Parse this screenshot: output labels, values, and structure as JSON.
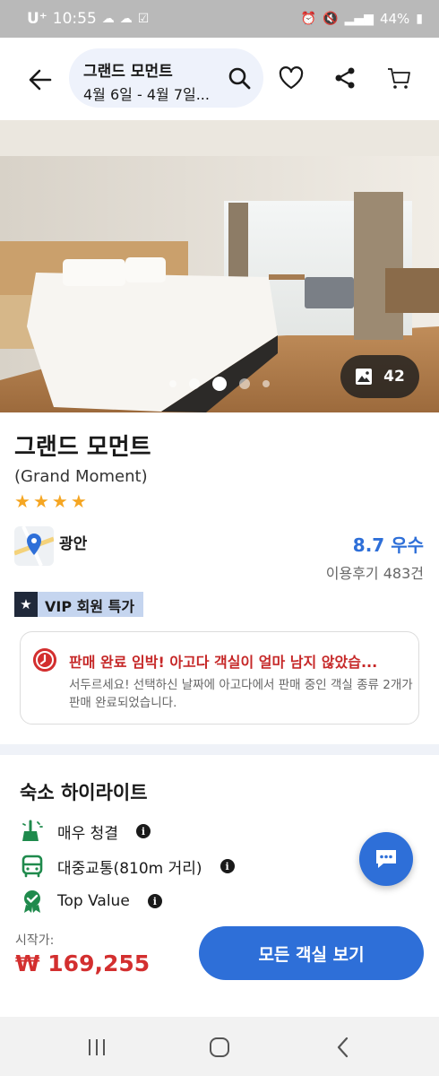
{
  "status_bar": {
    "carrier": "U⁺",
    "time": "10:55",
    "battery": "44%"
  },
  "header": {
    "hotel_title": "그랜드 모먼트",
    "dates": "4월 6일 - 4월 7일..."
  },
  "gallery": {
    "photo_count": "42",
    "total_dots": 5,
    "active_dot": 3
  },
  "hotel": {
    "name": "그랜드 모먼트",
    "english_name": "(Grand Moment)",
    "star_rating": 4,
    "location": "광안",
    "rating": "8.7 우수",
    "reviews": "이용후기 483건",
    "vip_badge": "VIP 회원 특가"
  },
  "alert": {
    "title": "판매 완료 임박! 아고다 객실이 얼마 남지 않았습...",
    "body": "서두르세요! 선택하신 날짜에 아고다에서 판매 중인 객실 종류 2개가 판매 완료되었습니다."
  },
  "highlights": {
    "title": "숙소 하이라이트",
    "items": [
      {
        "label": "매우 청결",
        "icon": "broom-icon"
      },
      {
        "label": "대중교통(810m 거리)",
        "icon": "bus-icon"
      },
      {
        "label": "Top Value",
        "icon": "award-badge-icon"
      }
    ]
  },
  "footer": {
    "price_label": "시작가:",
    "price": "₩ 169,255",
    "cta": "모든 객실 보기"
  },
  "colors": {
    "accent": "#2e6fd8",
    "alert_red": "#c62828",
    "price_red": "#d32f2f",
    "star": "#f5a623"
  }
}
